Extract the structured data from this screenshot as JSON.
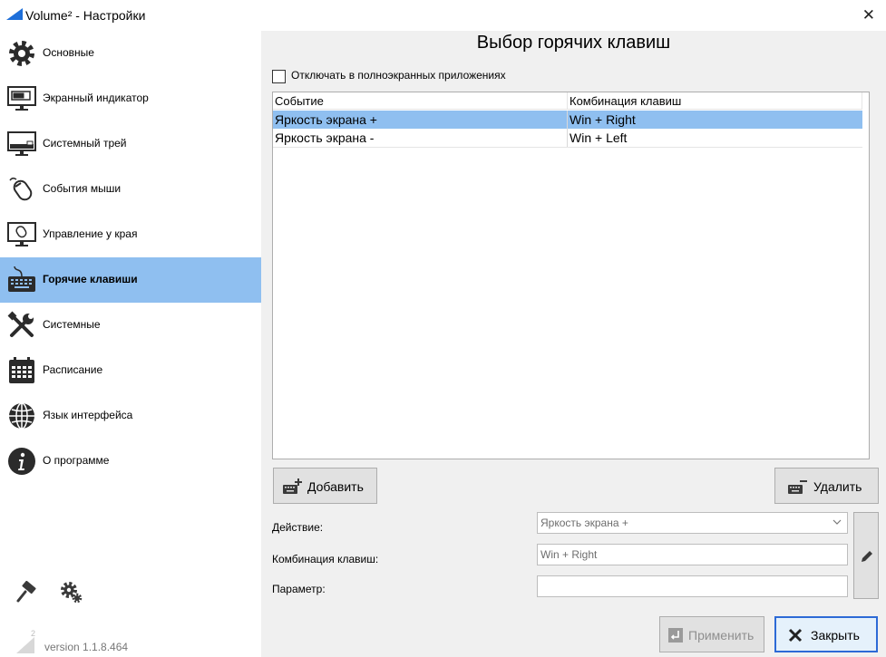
{
  "window": {
    "title": "Volume² - Настройки"
  },
  "sidebar": {
    "items": [
      {
        "label": "Основные",
        "icon": "gear-icon"
      },
      {
        "label": "Экранный индикатор",
        "icon": "monitor-indicator-icon"
      },
      {
        "label": "Системный трей",
        "icon": "monitor-tray-icon"
      },
      {
        "label": "События мыши",
        "icon": "mouse-icon"
      },
      {
        "label": "Управление у края",
        "icon": "monitor-edge-icon"
      },
      {
        "label": "Горячие клавиши",
        "icon": "keyboard-icon"
      },
      {
        "label": "Системные",
        "icon": "tools-icon"
      },
      {
        "label": "Расписание",
        "icon": "calendar-icon"
      },
      {
        "label": "Язык интерфейса",
        "icon": "globe-icon"
      },
      {
        "label": "О программе",
        "icon": "info-icon"
      }
    ],
    "active_index": 5,
    "version": "version 1.1.8.464"
  },
  "main": {
    "title": "Выбор горячих клавиш",
    "fullscreen_checkbox": {
      "label": "Отключать в полноэкранных приложениях",
      "checked": false
    },
    "table": {
      "columns": [
        "Событие",
        "Комбинация клавиш"
      ],
      "rows": [
        {
          "event": "Яркость экрана +",
          "combo": "Win + Right",
          "selected": true
        },
        {
          "event": "Яркость экрана -",
          "combo": "Win + Left",
          "selected": false
        }
      ]
    },
    "add_button": "Добавить",
    "remove_button": "Удалить",
    "form": {
      "action_label": "Действие:",
      "action_value": "Яркость экрана +",
      "combo_label": "Комбинация клавиш:",
      "combo_value": "Win + Right",
      "param_label": "Параметр:",
      "param_value": ""
    },
    "apply_button": "Применить",
    "close_button": "Закрыть"
  },
  "colors": {
    "selection": "#8fbff0",
    "focus_border": "#2d6ad6",
    "close_red": "#c42b1c"
  }
}
